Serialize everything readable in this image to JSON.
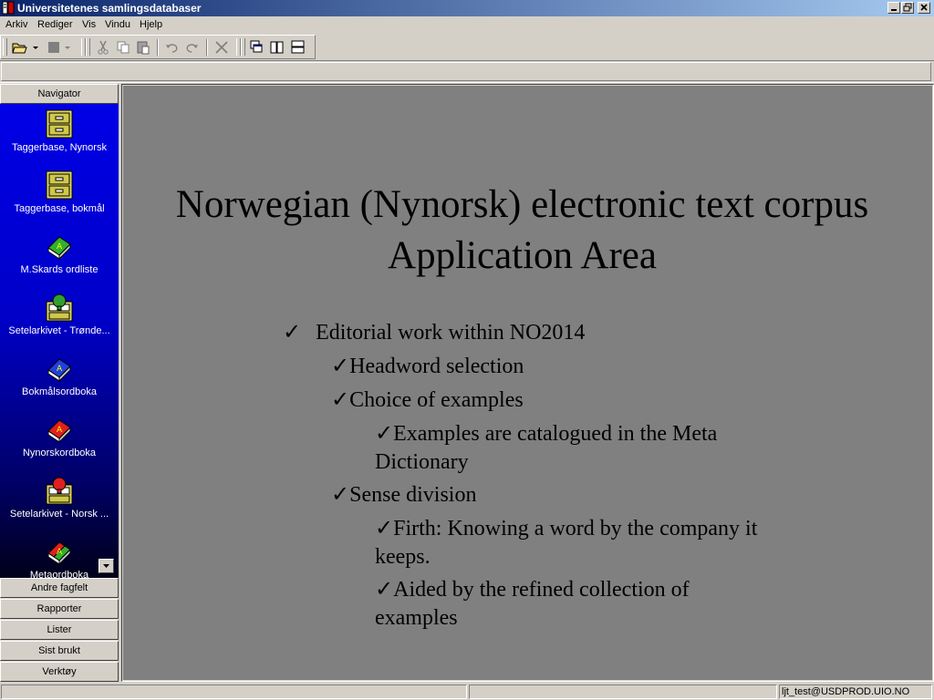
{
  "window": {
    "title": "Universitetenes samlingsdatabaser"
  },
  "menu": [
    "Arkiv",
    "Rediger",
    "Vis",
    "Vindu",
    "Hjelp"
  ],
  "navigator": {
    "header": "Navigator",
    "items": [
      {
        "label": "Taggerbase, Nynorsk",
        "icon": "file-cabinet-icon"
      },
      {
        "label": "Taggerbase, bokmål",
        "icon": "file-cabinet-icon"
      },
      {
        "label": "M.Skards ordliste",
        "icon": "green-book-icon"
      },
      {
        "label": "Setelarkivet - Trønde...",
        "icon": "card-index-green-icon"
      },
      {
        "label": "Bokmålsordboka",
        "icon": "blue-book-icon"
      },
      {
        "label": "Nynorskordboka",
        "icon": "red-book-icon"
      },
      {
        "label": "Setelarkivet - Norsk ...",
        "icon": "card-index-red-icon"
      },
      {
        "label": "Metaordboka",
        "icon": "multicolor-book-icon"
      }
    ],
    "sections": [
      "Andre fagfelt",
      "Rapporter",
      "Lister",
      "Sist brukt",
      "Verktøy"
    ]
  },
  "slide": {
    "title_line1": "Norwegian (Nynorsk) electronic text corpus",
    "title_line2": "Application Area",
    "bullets": [
      {
        "mark": "✓",
        "text": "Editorial work within NO2014"
      },
      {
        "mark": "✓",
        "text": "Headword selection"
      },
      {
        "mark": "✓",
        "text": "Choice of examples"
      },
      {
        "mark": "✓",
        "text": "Examples are catalogued in the Meta",
        "cont": "Dictionary"
      },
      {
        "mark": "✓",
        "text": "Sense division"
      },
      {
        "mark": "✓",
        "text": "Firth: Knowing a word by the company it",
        "cont": "keeps."
      },
      {
        "mark": "✓",
        "text": "Aided by the refined collection of",
        "cont": "examples"
      }
    ]
  },
  "status": {
    "user": "ljt_test@USDPROD.UIO.NO"
  },
  "colors": {
    "titlebar_start": "#0a246a",
    "nav_bg": "#0000e6",
    "slide_bg": "#808080"
  }
}
